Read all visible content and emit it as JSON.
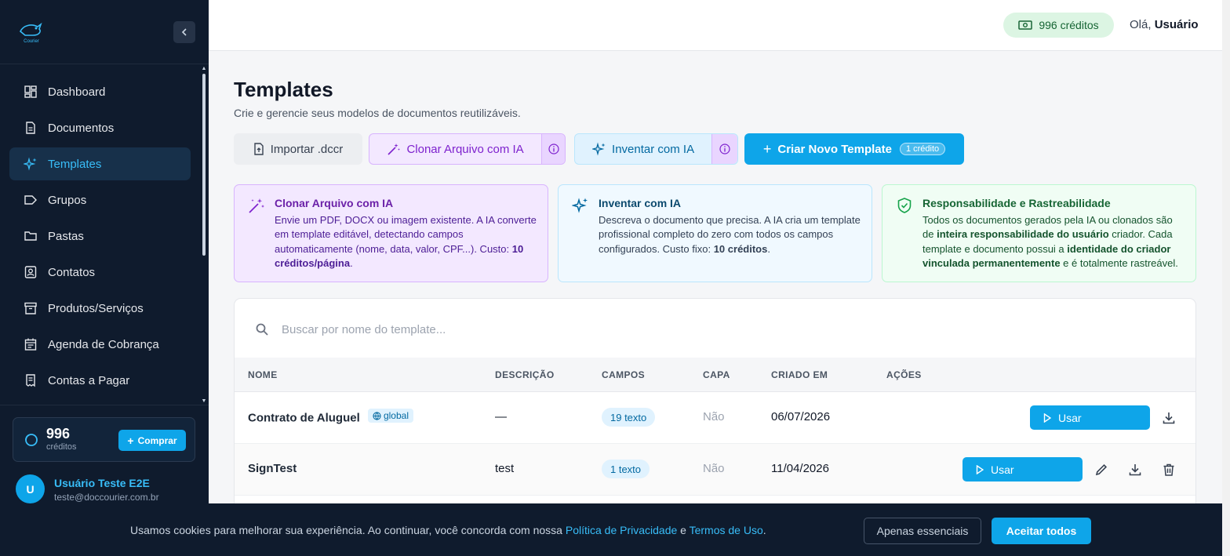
{
  "sidebar": {
    "logo_text": "Courier",
    "items": [
      {
        "label": "Dashboard",
        "icon": "dashboard-icon"
      },
      {
        "label": "Documentos",
        "icon": "document-icon"
      },
      {
        "label": "Templates",
        "icon": "sparkles-icon",
        "active": true
      },
      {
        "label": "Grupos",
        "icon": "tag-icon"
      },
      {
        "label": "Pastas",
        "icon": "folder-icon"
      },
      {
        "label": "Contatos",
        "icon": "contact-icon"
      },
      {
        "label": "Produtos/Serviços",
        "icon": "archive-icon"
      },
      {
        "label": "Agenda de Cobrança",
        "icon": "calendar-icon"
      },
      {
        "label": "Contas a Pagar",
        "icon": "receipt-icon"
      }
    ],
    "credits": {
      "value": "996",
      "label": "créditos",
      "buy_label": "Comprar"
    },
    "user": {
      "initial": "U",
      "name": "Usuário Teste E2E",
      "email": "teste@doccourier.com.br"
    }
  },
  "topbar": {
    "credits_label": "996 créditos",
    "greeting_prefix": "Olá,",
    "greeting_name": "Usuário"
  },
  "main": {
    "title": "Templates",
    "subtitle": "Crie e gerencie seus modelos de documentos reutilizáveis.",
    "actions": {
      "import_label": "Importar .dccr",
      "clone_label": "Clonar Arquivo com IA",
      "invent_label": "Inventar com IA",
      "new_label": "Criar Novo Template",
      "new_badge": "1 crédito"
    },
    "cards": {
      "clone": {
        "title": "Clonar Arquivo com IA",
        "text": "Envie um PDF, DOCX ou imagem existente. A IA converte em template editável, detectando campos automaticamente (nome, data, valor, CPF...). Custo: ",
        "strong": "10 créditos/página",
        "end": "."
      },
      "invent": {
        "title": "Inventar com IA",
        "text": "Descreva o documento que precisa. A IA cria um template profissional completo do zero com todos os campos configurados. Custo fixo: ",
        "strong": "10 créditos",
        "end": "."
      },
      "resp": {
        "title": "Responsabilidade e Rastreabilidade",
        "t1": "Todos os documentos gerados pela IA ou clonados são de ",
        "s1": "inteira responsabilidade do usuário",
        "t2": " criador. Cada template e documento possui a ",
        "s2": "identidade do criador vinculada permanentemente",
        "t3": " e é totalmente rastreável."
      }
    },
    "search_placeholder": "Buscar por nome do template...",
    "table": {
      "headers": [
        "NOME",
        "DESCRIÇÃO",
        "CAMPOS",
        "CAPA",
        "CRIADO EM",
        "AÇÕES"
      ],
      "rows": [
        {
          "name": "Contrato de Aluguel",
          "badge": "global",
          "description": "—",
          "fields": "19 texto",
          "cover": "Não",
          "created": "06/07/2026",
          "use_label": "Usar"
        },
        {
          "name": "SignTest",
          "badge": "",
          "description": "test",
          "fields": "1 texto",
          "cover": "Não",
          "created": "11/04/2026",
          "use_label": "Usar"
        }
      ]
    }
  },
  "cookie": {
    "text": "Usamos cookies para melhorar sua experiência. Ao continuar, você concorda com nossa ",
    "privacy_link": "Política de Privacidade",
    "and": " e ",
    "terms_link": "Termos de Uso",
    "end": ".",
    "essential_label": "Apenas essenciais",
    "accept_label": "Aceitar todos"
  }
}
